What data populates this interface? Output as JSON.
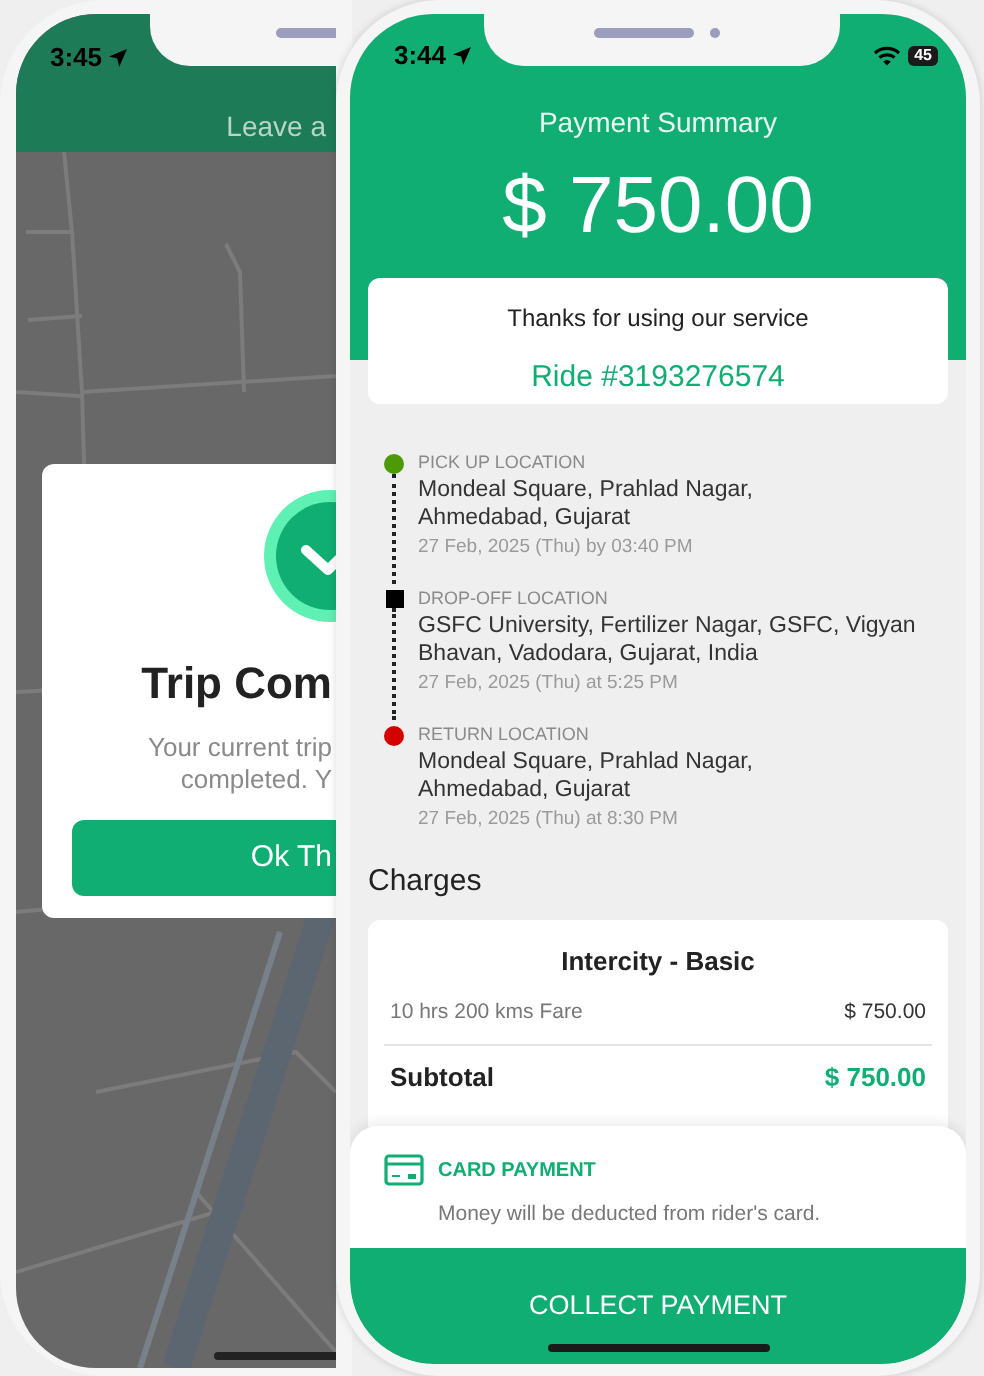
{
  "left_phone": {
    "status_bar": {
      "time": "3:45"
    },
    "header": {
      "title": "Leave a"
    },
    "dialog": {
      "title": "Trip Com",
      "message_lines": [
        "Your current trip",
        "completed. Y"
      ],
      "button": "Ok Th"
    }
  },
  "right_phone": {
    "status_bar": {
      "time": "3:44",
      "battery": "45"
    },
    "summary": {
      "title": "Payment Summary",
      "amount": "$ 750.00"
    },
    "thanks_card": {
      "message": "Thanks for using our service",
      "ride": "Ride #3193276574"
    },
    "stops": [
      {
        "kind": "pickup",
        "color": "#4e9a06",
        "label": "PICK UP LOCATION",
        "address_lines": [
          "Mondeal Square, Prahlad Nagar,",
          "Ahmedabad, Gujarat"
        ],
        "time": "27 Feb, 2025 (Thu) by 03:40 PM"
      },
      {
        "kind": "dropoff",
        "color": "#000000",
        "label": "DROP-OFF LOCATION",
        "address_lines": [
          "GSFC University, Fertilizer Nagar, GSFC, Vigyan",
          "Bhavan, Vadodara, Gujarat, India"
        ],
        "time": "27 Feb, 2025 (Thu) at 5:25 PM"
      },
      {
        "kind": "return",
        "color": "#d50000",
        "label": "RETURN LOCATION",
        "address_lines": [
          "Mondeal Square, Prahlad Nagar,",
          "Ahmedabad, Gujarat"
        ],
        "time": "27 Feb, 2025 (Thu) at 8:30 PM"
      }
    ],
    "charges": {
      "title": "Charges",
      "card": {
        "title": "Intercity - Basic",
        "items": [
          {
            "label": "10 hrs 200 kms Fare",
            "amount": "$ 750.00"
          }
        ],
        "subtotal": {
          "label": "Subtotal",
          "amount": "$ 750.00"
        }
      }
    },
    "payment": {
      "title": "CARD PAYMENT",
      "note": "Money will be deducted from rider's card."
    },
    "button": "COLLECT PAYMENT"
  }
}
